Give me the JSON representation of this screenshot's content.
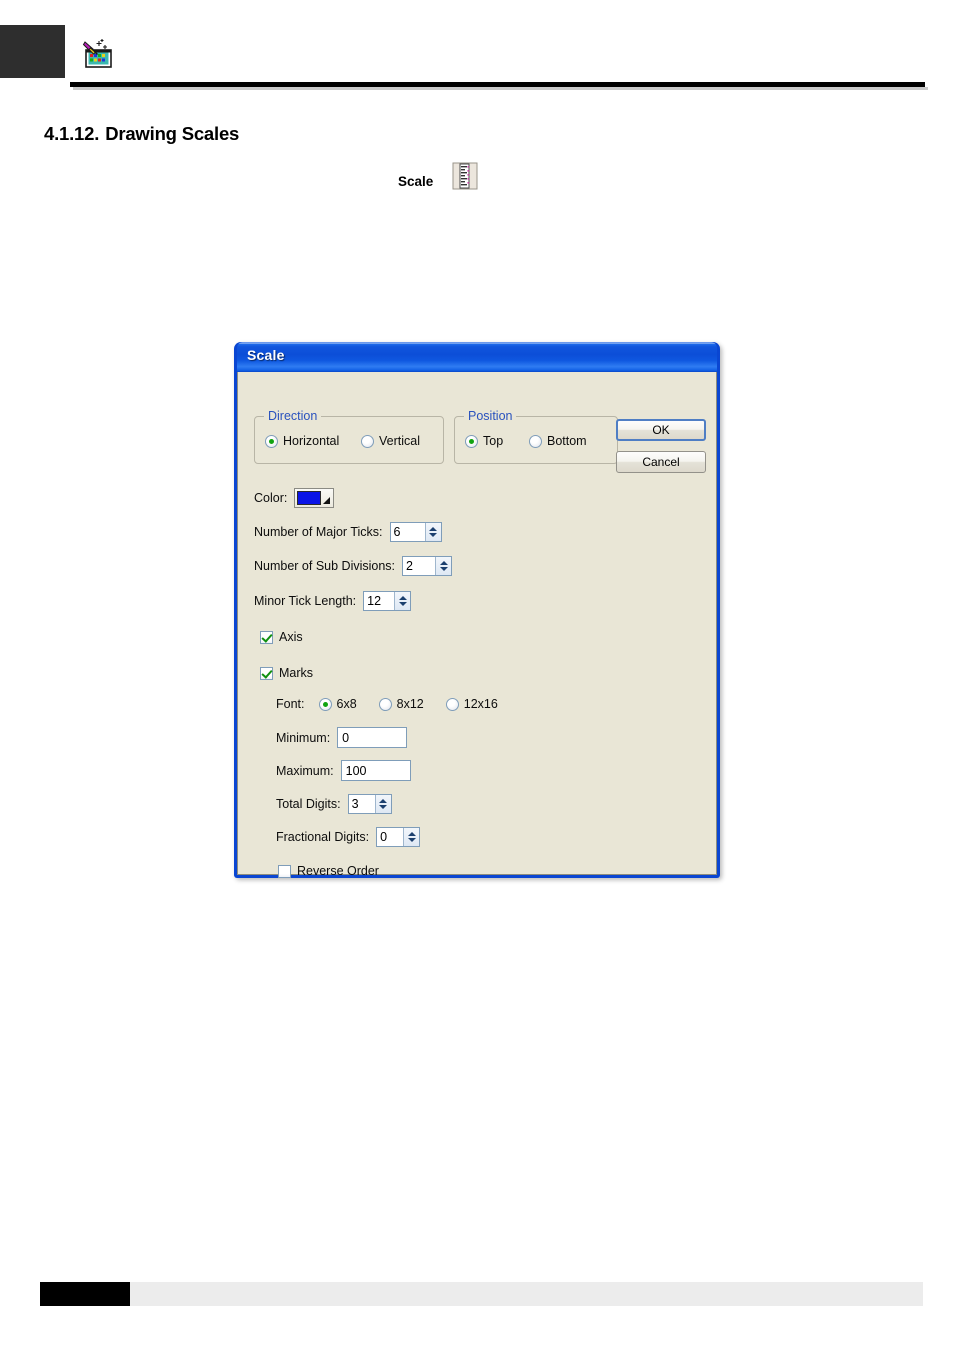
{
  "page": {
    "header_icon": "paint-palette-icon",
    "section_number": "4.1.12.",
    "section_title": "Drawing Scales",
    "scale_caption": "Scale",
    "scale_icon": "ruler-scale-icon"
  },
  "dialog": {
    "title": "Scale",
    "buttons": {
      "ok": "OK",
      "cancel": "Cancel"
    },
    "direction": {
      "legend": "Direction",
      "options": [
        {
          "label": "Horizontal",
          "checked": true
        },
        {
          "label": "Vertical",
          "checked": false
        }
      ]
    },
    "position": {
      "legend": "Position",
      "options": [
        {
          "label": "Top",
          "checked": true
        },
        {
          "label": "Bottom",
          "checked": false
        }
      ]
    },
    "color": {
      "label": "Color:",
      "value": "#0a14e6"
    },
    "fields": [
      {
        "label": "Number of Major Ticks:",
        "value": "6"
      },
      {
        "label": "Number of Sub Divisions:",
        "value": "2"
      },
      {
        "label": "Minor Tick Length:",
        "value": "12"
      }
    ],
    "axis": {
      "label": "Axis",
      "checked": true
    },
    "marks": {
      "label": "Marks",
      "checked": true
    },
    "font": {
      "label": "Font:",
      "options": [
        {
          "label": "6x8",
          "checked": true
        },
        {
          "label": "8x12",
          "checked": false
        },
        {
          "label": "12x16",
          "checked": false
        }
      ]
    },
    "minimum": {
      "label": "Minimum:",
      "value": "0"
    },
    "maximum": {
      "label": "Maximum:",
      "value": "100"
    },
    "total_digits": {
      "label": "Total Digits:",
      "value": "3"
    },
    "fractional_digits": {
      "label": "Fractional Digits:",
      "value": "0"
    },
    "reverse_order": {
      "label": "Reverse Order",
      "checked": false
    }
  }
}
